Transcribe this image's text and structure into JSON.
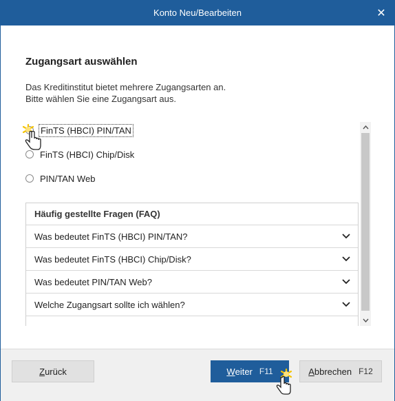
{
  "window": {
    "title": "Konto Neu/Bearbeiten",
    "close_label": "✕"
  },
  "content": {
    "heading": "Zugangsart auswählen",
    "description_line1": "Das Kreditinstitut bietet mehrere Zugangsarten an.",
    "description_line2": "Bitte wählen Sie eine Zugangsart aus."
  },
  "options": [
    {
      "label": "FinTS (HBCI) PIN/TAN",
      "focused": true
    },
    {
      "label": "FinTS (HBCI) Chip/Disk",
      "focused": false
    },
    {
      "label": "PIN/TAN Web",
      "focused": false
    }
  ],
  "faq": {
    "title": "Häufig gestellte Fragen (FAQ)",
    "items": [
      "Was bedeutet FinTS (HBCI) PIN/TAN?",
      "Was bedeutet FinTS (HBCI) Chip/Disk?",
      "Was bedeutet PIN/TAN Web?",
      "Welche Zugangsart sollte ich wählen?"
    ]
  },
  "buttons": {
    "back": {
      "mnemonic": "Z",
      "rest": "urück"
    },
    "next": {
      "mnemonic": "W",
      "rest": "eiter",
      "shortcut": "F11"
    },
    "cancel": {
      "mnemonic": "A",
      "rest": "bbrechen",
      "shortcut": "F12"
    }
  },
  "colors": {
    "accent": "#1f5d9b",
    "footer_bg": "#f0f0f0",
    "cursor_highlight": "#f5c400"
  },
  "icons": {
    "close": "close-icon",
    "chevron": "chevron-down-icon",
    "scroll_up": "scroll-up-arrow-icon",
    "scroll_down": "scroll-down-arrow-icon",
    "cursor": "hand-pointer-cursor-icon"
  }
}
